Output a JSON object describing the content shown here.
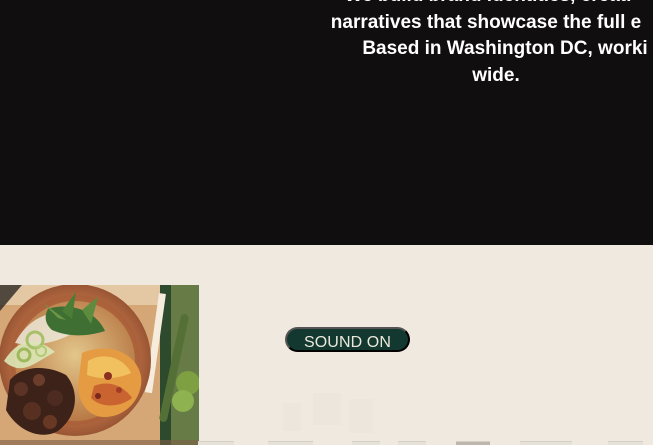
{
  "hero": {
    "lines": [
      "We build brand identities, creati",
      "narratives that showcase the full e",
      "Based in Washington DC, worki",
      "wide."
    ]
  },
  "content": {
    "sound_button_label": "SOUND ON"
  },
  "colors": {
    "hero_background": "#100e0f",
    "content_background": "#efe9df",
    "button_background": "#13382f",
    "button_text": "#ece8dc"
  },
  "icons": {
    "food_image": "food-photo"
  }
}
